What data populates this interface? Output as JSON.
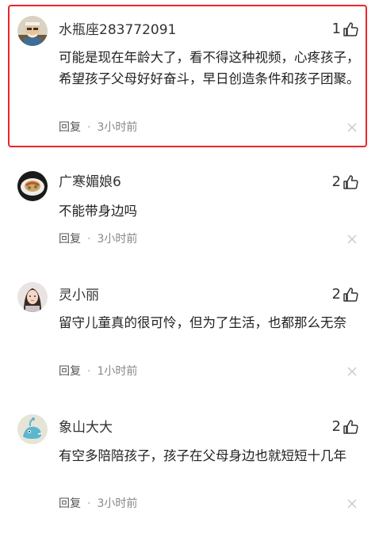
{
  "comments": [
    {
      "username": "水瓶座283772091",
      "likes": "1",
      "text": "可能是现在年龄大了，看不得这种视频，心疼孩子，希望孩子父母好好奋斗，早日创造条件和孩子团聚。",
      "reply_label": "回复",
      "separator": "·",
      "time": "3小时前",
      "highlighted": true,
      "avatar_icon": "elderly-man-avatar"
    },
    {
      "username": "广寒媚娘6",
      "likes": "2",
      "text": "不能带身边吗",
      "reply_label": "回复",
      "separator": "·",
      "time": "3小时前",
      "highlighted": false,
      "avatar_icon": "food-dish-avatar"
    },
    {
      "username": "灵小丽",
      "likes": "2",
      "text": "留守儿童真的很可怜，但为了生活，也都那么无奈",
      "reply_label": "回复",
      "separator": "·",
      "time": "1小时前",
      "highlighted": false,
      "avatar_icon": "woman-portrait-avatar"
    },
    {
      "username": "象山大大",
      "likes": "2",
      "text": "有空多陪陪孩子，孩子在父母身边也就短短十几年",
      "reply_label": "回复",
      "separator": "·",
      "time": "3小时前",
      "highlighted": false,
      "avatar_icon": "cartoon-bird-avatar"
    }
  ],
  "colors": {
    "highlight_border": "#e8262a",
    "text": "#222222",
    "meta": "#888888"
  }
}
